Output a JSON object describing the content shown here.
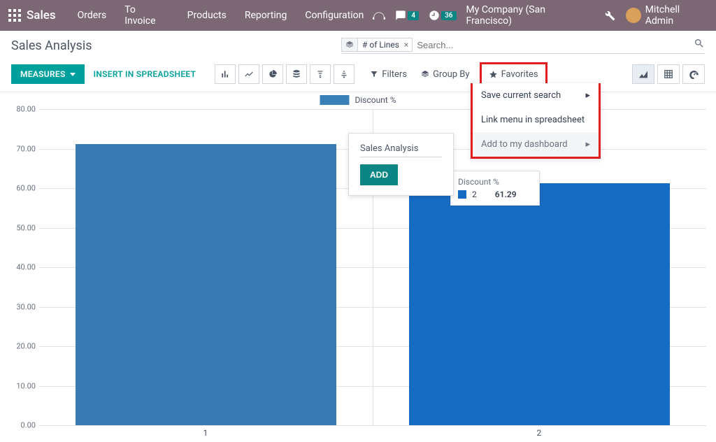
{
  "nav": {
    "brand": "Sales",
    "items": [
      "Orders",
      "To Invoice",
      "Products",
      "Reporting",
      "Configuration"
    ],
    "messages_badge": "4",
    "activities_badge": "36",
    "company": "My Company (San Francisco)",
    "user": "Mitchell Admin"
  },
  "cp": {
    "title": "Sales Analysis",
    "facet_label": "# of Lines",
    "search_placeholder": "Search...",
    "measures_btn": "MEASURES",
    "insert_btn": "INSERT IN SPREADSHEET",
    "filters": "Filters",
    "groupby": "Group By",
    "favorites": "Favorites"
  },
  "fav_menu": {
    "save": "Save current search",
    "link": "Link menu in spreadsheet",
    "add": "Add to my dashboard"
  },
  "dash_popup": {
    "name": "Sales Analysis",
    "add_btn": "ADD"
  },
  "legend": {
    "label": "Discount %"
  },
  "tooltip": {
    "title": "Discount %",
    "cat": "2",
    "val": "61.29"
  },
  "chart_data": {
    "type": "bar",
    "title": "Discount %",
    "categories": [
      "1",
      "2"
    ],
    "values": [
      71.1,
      61.29
    ],
    "ylabel": "",
    "xlabel": "",
    "ylim": [
      0,
      80
    ],
    "yticks": [
      "0.00",
      "10.00",
      "20.00",
      "30.00",
      "40.00",
      "50.00",
      "60.00",
      "70.00",
      "80.00"
    ]
  }
}
